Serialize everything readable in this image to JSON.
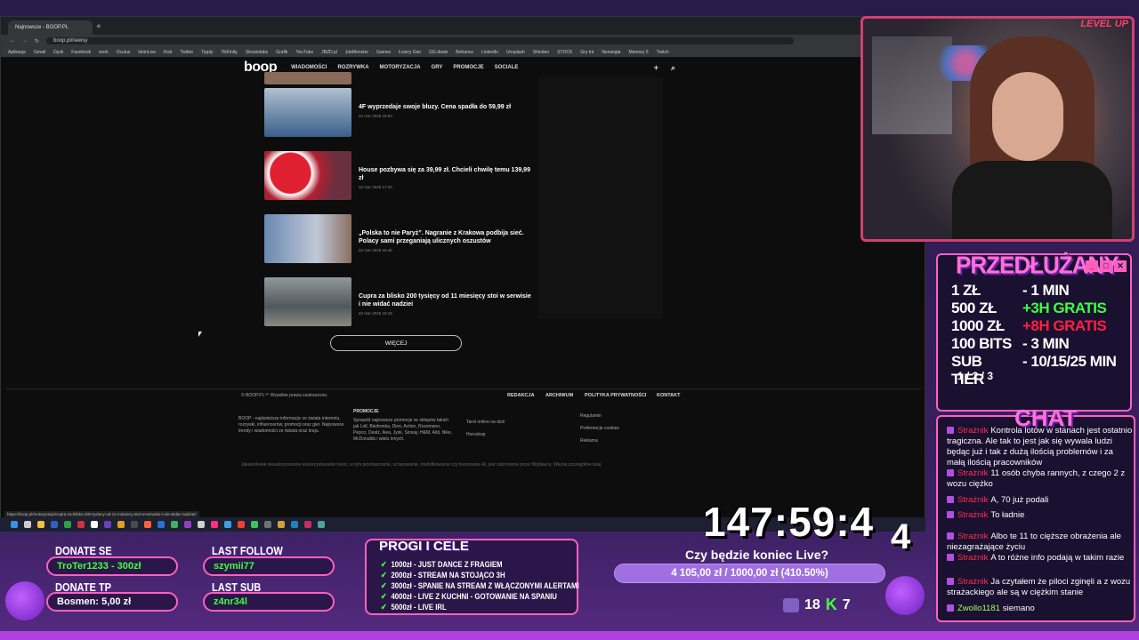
{
  "browser": {
    "tab_title": "Najnowsze - BOOP.PL",
    "url": "boop.pl/newsy",
    "bookmarks": [
      "Aplikacje",
      "Gmail",
      "Dysk",
      "Facebook",
      "work",
      "Oculus",
      "IshinLive",
      "Kick",
      "Twitter",
      "Tipply",
      "TikFinity",
      "Streamlabs",
      "Grafik",
      "YouTube",
      "JBZD.pl",
      "JobMonster",
      "Games",
      "Łowcy Gier",
      "GG.deals",
      "Behance",
      "LinkedIn",
      "Unsplash",
      "Shinden",
      "STOCK",
      "Gry tnt",
      "Norwegia",
      "Memory 5",
      "Twitch"
    ],
    "status_url": "https://boop.pl/motoryzacja/cupra-za-blisko-200-tysiecy-od-11-miesiecy-stoi-w-serwisie-i-nie-widac-nadziei/"
  },
  "site": {
    "logo": "boop",
    "nav": [
      "WIADOMOŚCI",
      "ROZRYWKA",
      "MOTORYZACJA",
      "GRY",
      "PROMOCJE",
      "SOCIALE"
    ],
    "articles": [
      {
        "title": "4F wyprzedaje swoje bluzy. Cena spadła do 59,99 zł",
        "date": "22 mar 2026 18:00",
        "color": "#3a5f8a"
      },
      {
        "title": "House pozbywa się za 39,99 zł. Chcieli chwilę temu 139,99 zł",
        "date": "22 mar 2026 17:40",
        "color": "#b02030"
      },
      {
        "title": "„Polska to nie Paryż”. Nagranie z Krakowa podbija sieć. Polacy sami przeganiają ulicznych oszustów",
        "date": "22 mar 2026 15:46",
        "color": "#6a88b0"
      },
      {
        "title": "Cupra za blisko 200 tysięcy od 11 miesięcy stoi w serwisie i nie widać nadziei",
        "date": "22 mar 2026 15:19",
        "color": "#707880"
      }
    ],
    "more_label": "WIĘCEJ",
    "footer": {
      "copyright": "© BOOP.PL™ Wszelkie prawa zastrzeżone.",
      "links": [
        "REDAKCJA",
        "ARCHIWUM",
        "POLITYKA PRYWATNOŚCI",
        "KONTAKT"
      ],
      "about": "BOOP - najświeższe informacje ze świata internetu, rozrywki, influencerów, promocji oraz gier. Najnowsze trendy i wiadomości ze świata oraz kraju.",
      "promo_title": "PROMOCJE",
      "promo_text": "Sprawdź najnowsze promocje ze sklepów takich jak Lidl, Biedronka, Dino, Action, Rossmann, Pepco, Dealz, Ikea, Jysk, Sinsay, H&M, Aldi, Nike, McDonalds i wielu innych.",
      "extra1": "Tarot online na dziś",
      "extra2": "Horoskop",
      "legal": [
        "Regulamin",
        "Preferencje cookies",
        "Reklama"
      ],
      "disclaimer": "Jakiekolwiek nieautoryzowane wykorzystywanie treści, w tym przetwarzanie, scrapowanie, modyfikowanie czy trenowanie AI, jest zabronione przez Wydawcę. Więcej szczegółów tutaj"
    }
  },
  "overlay": {
    "levelup": "LEVEL UP",
    "extension": {
      "title": "PRZEDŁUŻANY",
      "rows": [
        {
          "k": "1 ZŁ",
          "v": "- 1 MIN",
          "cls": ""
        },
        {
          "k": "500 ZŁ",
          "v": "+3H GRATIS",
          "cls": "green"
        },
        {
          "k": "1000 ZŁ",
          "v": "+8H GRATIS",
          "cls": "red"
        },
        {
          "k": "100 BITS",
          "v": "- 3 MIN",
          "cls": ""
        },
        {
          "k": "SUB TIER",
          "v": "- 10/15/25 MIN",
          "cls": ""
        }
      ],
      "sub_tiers": "1 / 2 / 3"
    },
    "chat": {
      "title": "CHAT",
      "messages": [
        {
          "user": "Strażnik",
          "text": "Kontrola lotów w stanach jest ostatnio tragiczna. Ale tak to jest jak się wywala ludzi będąc już i tak z dużą ilością problemów i za małą ilością pracowników",
          "alt": false
        },
        {
          "user": "Strażnik",
          "text": "11 osób chyba rannych, z czego 2 z wozu ciężko",
          "alt": false
        },
        {
          "user": "Strażnik",
          "text": "A, 70 już podali",
          "alt": false
        },
        {
          "user": "Strażnik",
          "text": "To ładnie",
          "alt": false
        },
        {
          "user": "Strażnik",
          "text": "Albo te 11 to cięższe obrażenia ale niezagrażające życiu",
          "alt": false
        },
        {
          "user": "Strażnik",
          "text": "A to różne info podają w takim razie",
          "alt": false
        },
        {
          "user": "Strażnik",
          "text": "Ja czytałem że piloci zginęli a z wozu strażackiego ale są w ciężkim stanie",
          "alt": false
        },
        {
          "user": "Zwollo1181",
          "text": "siemano",
          "alt": true
        }
      ]
    },
    "timer": "147:59:4",
    "timer_extra": "4",
    "donate_se_label": "DONATE SE",
    "donate_se_value": "TroTer1233 - 300zł",
    "donate_tp_label": "DONATE TP",
    "donate_tp_value": "Bosmen: 5,00 zł",
    "last_follow_label": "LAST FOLLOW",
    "last_follow_value": "szymii77",
    "last_sub_label": "LAST SUB",
    "last_sub_value": "z4nr34l",
    "goals": {
      "title": "PROGI I CELE",
      "items": [
        "1000zł - JUST DANCE Z FRAGIEM",
        "2000zł - STREAM NA STOJĄCO 3H",
        "3000zł - SPANIE NA STREAM Z WŁĄCZONYMI ALERTAMI",
        "4000zł - LIVE Z KUCHNI - GOTOWANIE NA SPANIU",
        "5000zł - LIVE IRL"
      ]
    },
    "end_question": "Czy będzie koniec Live?",
    "progress_text": "4 105,00 zł / 1000,00 zł (410.50%)",
    "progress_fraction": 1.0,
    "viewers_twitch": "18",
    "viewers_kick": "7"
  }
}
